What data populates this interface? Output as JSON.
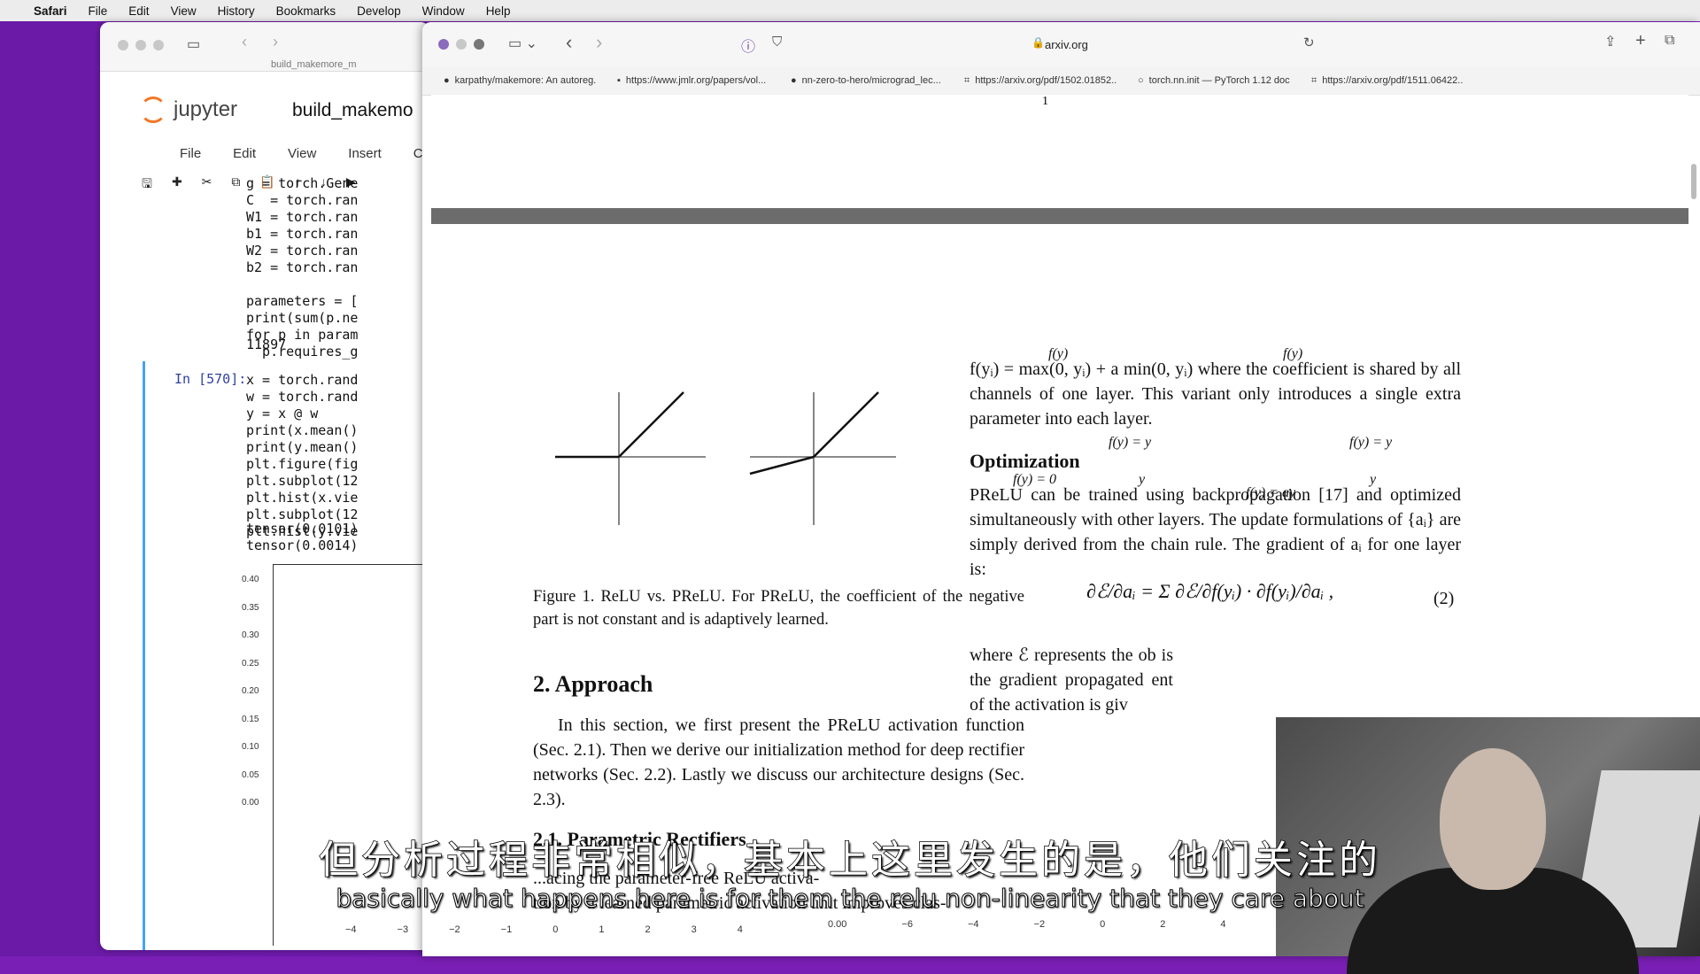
{
  "menubar": {
    "app": "Safari",
    "items": [
      "File",
      "Edit",
      "View",
      "History",
      "Bookmarks",
      "Develop",
      "Window",
      "Help"
    ]
  },
  "jupyter": {
    "tab": "build_makemore_m",
    "logo": "jupyter",
    "title": "build_makemo",
    "menu": [
      "File",
      "Edit",
      "View",
      "Insert",
      "Ce"
    ],
    "code1": "g = torch.Gene\nC  = torch.ran\nW1 = torch.ran\nb1 = torch.ran\nW2 = torch.ran\nb2 = torch.ran\n\nparameters = [\nprint(sum(p.ne\nfor p in param\n  p.requires_g",
    "output1": "11897",
    "prompt": "In [570]:",
    "code2": "x = torch.rand\nw = torch.rand\ny = x @ w\nprint(x.mean()\nprint(y.mean()\nplt.figure(fig\nplt.subplot(12\nplt.hist(x.vie\nplt.subplot(12\nplt.hist(y.vie",
    "output2": "tensor(0.0101)\ntensor(0.0014)",
    "yticks": [
      "0.40",
      "0.35",
      "0.30",
      "0.25",
      "0.20",
      "0.15",
      "0.10",
      "0.05",
      "0.00"
    ],
    "xticks": [
      "−4",
      "−3",
      "−2",
      "−1",
      "0",
      "1",
      "2",
      "3",
      "4"
    ],
    "xticks2": [
      "0.00",
      "−6",
      "−4",
      "−2",
      "0",
      "2",
      "4"
    ]
  },
  "safari": {
    "url": "arxiv.org",
    "bookmarks": [
      {
        "icon": "github-icon",
        "label": "karpathy/makemore: An autoreg..."
      },
      {
        "icon": "jmlr-icon",
        "label": "https://www.jmlr.org/papers/vol..."
      },
      {
        "icon": "github-icon",
        "label": "nn-zero-to-hero/micrograd_lec..."
      },
      {
        "icon": "arxiv-icon",
        "label": "https://arxiv.org/pdf/1502.01852..."
      },
      {
        "icon": "pytorch-icon",
        "label": "torch.nn.init — PyTorch 1.12 doc..."
      },
      {
        "icon": "arxiv-icon",
        "label": "https://arxiv.org/pdf/1511.06422..."
      }
    ],
    "page_marker": "1"
  },
  "paper": {
    "fig_labels": {
      "fy": "f(y)",
      "fy_eq_y": "f(y) = y",
      "fy_eq_0": "f(y) = 0",
      "fy_eq_ay": "f(y) = ay",
      "y": "y"
    },
    "caption": "Figure 1. ReLU vs. PReLU. For PReLU, the coefficient of the negative part is not constant and is adaptively learned.",
    "section": "2. Approach",
    "approach_text": "In this section, we first present the PReLU activation function (Sec. 2.1). Then we derive our initialization method for deep rectifier networks (Sec. 2.2). Lastly we discuss our architecture designs (Sec. 2.3).",
    "subsection": "2.1. Parametric Rectifiers",
    "sub_text_partial": "...acing the parameter-free ReLU activa-",
    "sub_text_line2": "tion by a learned parametric activation unit improves clas-",
    "right_top": "f(yᵢ) = max(0, yᵢ) + a min(0, yᵢ) where the coefficient is shared by all channels of one layer. This variant only introduces a single extra parameter into each layer.",
    "opt_heading": "Optimization",
    "opt_text": "PReLU can be trained using backpropagation [17] and optimized simultaneously with other layers. The update formulations of {aᵢ} are simply derived from the chain rule. The gradient of aᵢ for one layer is:",
    "equation": "∂ℰ/∂aᵢ = Σ ∂ℰ/∂f(yᵢ) · ∂f(yᵢ)/∂aᵢ ,",
    "eq_number": "(2)",
    "after_eq": "where ℰ represents the ob is the gradient propagated ent of the activation is giv"
  },
  "subtitles": {
    "zh": "但分析过程非常相似，基本上这里发生的是，他们关注的",
    "en": "basically what happens here is for them the relu non-linearity that they care about"
  },
  "colors": {
    "wallpaper": "#7a1fb5",
    "jupyter_orange": "#f37726",
    "cell_blue": "#42a5f5"
  }
}
